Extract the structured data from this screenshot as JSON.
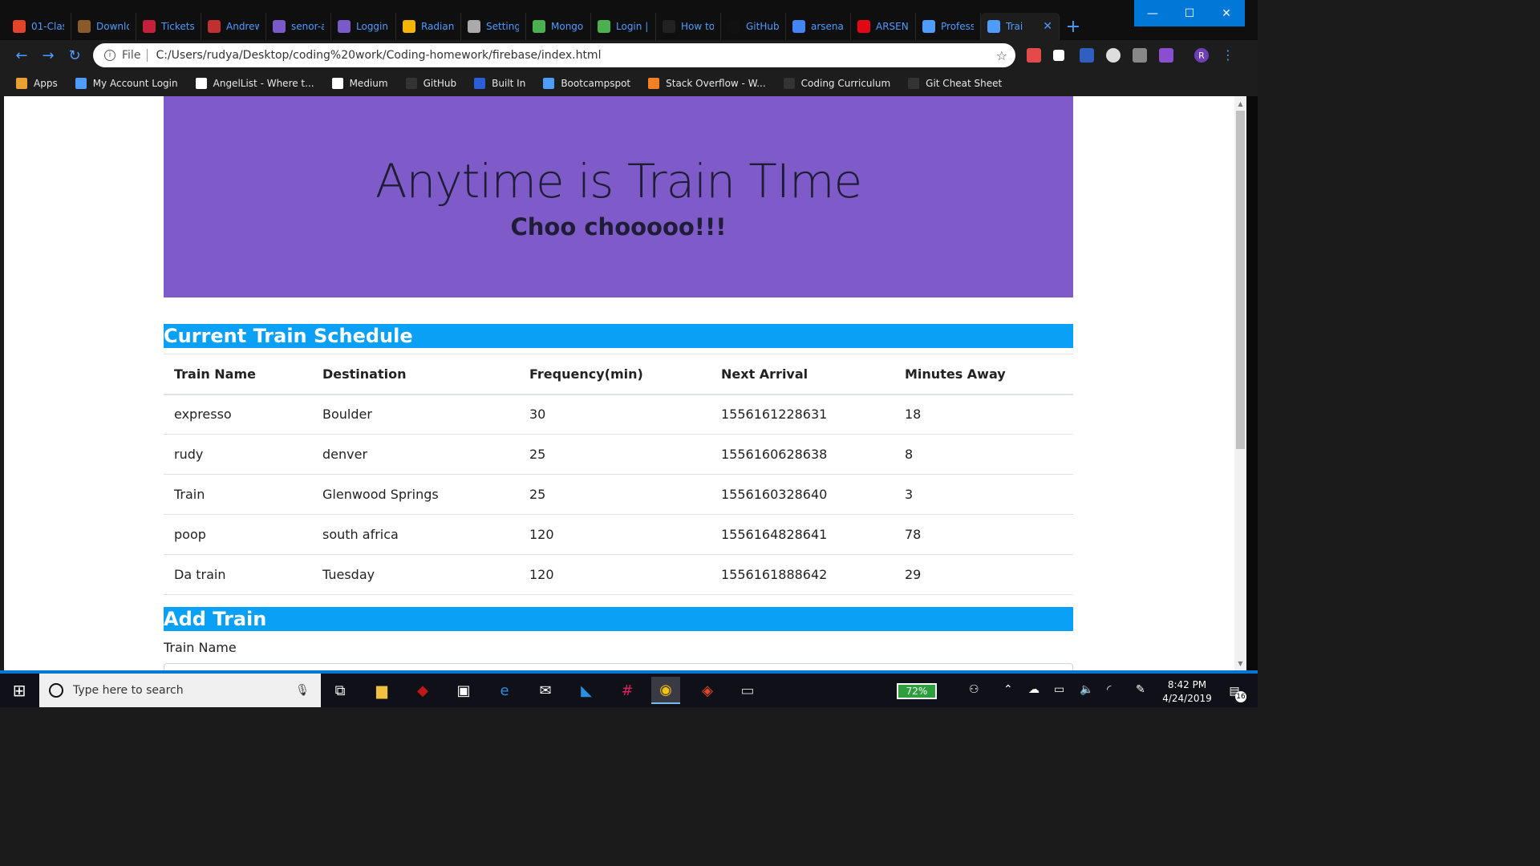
{
  "browser": {
    "tabs": [
      {
        "label": "01-Clas",
        "icon": "gitlab-icon",
        "color": "#e24329"
      },
      {
        "label": "Downlo",
        "icon": "download-icon",
        "color": "#8a5a2b"
      },
      {
        "label": "Tickets",
        "icon": "ticket-icon",
        "color": "#c4203c"
      },
      {
        "label": "Andrew",
        "icon": "avatar-icon",
        "color": "#c03030"
      },
      {
        "label": "senor-a",
        "icon": "hyper-icon",
        "color": "#7a5ac8"
      },
      {
        "label": "Loggin",
        "icon": "hyper-icon",
        "color": "#7a5ac8"
      },
      {
        "label": "Radian",
        "icon": "walmart-icon",
        "color": "#f5b400"
      },
      {
        "label": "Setting",
        "icon": "code-icon",
        "color": "#aaaaaa"
      },
      {
        "label": "Mongo",
        "icon": "mongodb-icon",
        "color": "#4caf50"
      },
      {
        "label": "Login |",
        "icon": "mongodb-icon",
        "color": "#4caf50"
      },
      {
        "label": "How to",
        "icon": "htg-icon",
        "color": "#222222"
      },
      {
        "label": "GitHub",
        "icon": "github-icon",
        "color": "#111111"
      },
      {
        "label": "arsenal",
        "icon": "google-icon",
        "color": "#4285f4"
      },
      {
        "label": "ARSENA",
        "icon": "puma-icon",
        "color": "#e30613"
      },
      {
        "label": "Profess",
        "icon": "page-icon",
        "color": "#4f9cff"
      },
      {
        "label": "Trai",
        "icon": "page-icon",
        "color": "#4f9cff"
      }
    ],
    "new_tab": "+",
    "window_controls": {
      "minimize": "—",
      "maximize": "☐",
      "close": "✕"
    },
    "address": {
      "scheme_label": "File",
      "url": "C:/Users/rudya/Desktop/coding%20work/Coding-homework/firebase/index.html"
    },
    "profile_initial": "R",
    "bookmarks": [
      {
        "label": "Apps",
        "icon": "apps-grid-icon"
      },
      {
        "label": "My Account Login",
        "icon": "page-icon"
      },
      {
        "label": "AngelList - Where t...",
        "icon": "angellist-icon"
      },
      {
        "label": "Medium",
        "icon": "medium-icon"
      },
      {
        "label": "GitHub",
        "icon": "github-icon"
      },
      {
        "label": "Built In",
        "icon": "builtin-icon"
      },
      {
        "label": "Bootcampspot",
        "icon": "page-icon"
      },
      {
        "label": "Stack Overflow - W...",
        "icon": "stackoverflow-icon"
      },
      {
        "label": "Coding Curriculum",
        "icon": "github-icon"
      },
      {
        "label": "Git Cheat Sheet",
        "icon": "github-icon"
      }
    ]
  },
  "page": {
    "jumbotron": {
      "title": "Anytime is Train TIme",
      "subtitle": "Choo chooooo!!!"
    },
    "schedule": {
      "heading": "Current Train Schedule",
      "columns": [
        "Train Name",
        "Destination",
        "Frequency(min)",
        "Next Arrival",
        "Minutes Away"
      ],
      "rows": [
        [
          "expresso",
          "Boulder",
          "30",
          "1556161228631",
          "18"
        ],
        [
          "rudy",
          "denver",
          "25",
          "1556160628638",
          "8"
        ],
        [
          "Train",
          "Glenwood Springs",
          "25",
          "1556160328640",
          "3"
        ],
        [
          "poop",
          "south africa",
          "120",
          "1556164828641",
          "78"
        ],
        [
          "Da train",
          "Tuesday",
          "120",
          "1556161888642",
          "29"
        ]
      ]
    },
    "add_train": {
      "heading": "Add Train",
      "train_name_label": "Train Name"
    },
    "colors": {
      "jumbotron": "#7e5bc9",
      "section_header": "#0aa0f5"
    }
  },
  "taskbar": {
    "search_placeholder": "Type here to search",
    "battery": "72%",
    "time": "8:42 PM",
    "date": "4/24/2019",
    "notification_count": "16"
  }
}
